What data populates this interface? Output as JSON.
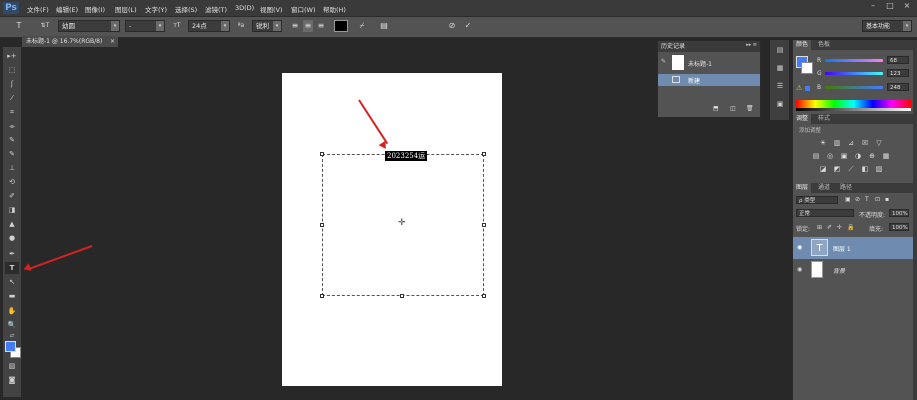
{
  "app": {
    "logo": "Ps"
  },
  "menu": [
    "文件(F)",
    "编辑(E)",
    "图像(I)",
    "图层(L)",
    "文字(Y)",
    "选择(S)",
    "滤镜(T)",
    "3D(D)",
    "视图(V)",
    "窗口(W)",
    "帮助(H)"
  ],
  "window_controls": {
    "minimize": "–",
    "maximize": "□",
    "close": "×"
  },
  "options": {
    "tool_glyph": "T",
    "orient_glyph": "⇅T",
    "font_family": "幼圆",
    "font_style": "-",
    "size_glyph": "тT",
    "font_size": "24点",
    "aa_glyph": "ªa",
    "antialias": "锐利",
    "align_left": "≡",
    "align_center": "≡",
    "align_right": "≡",
    "color_hex": "#000000",
    "warp_glyph": "⌿",
    "panel_glyph": "▤",
    "cancel_glyph": "⊘",
    "commit_glyph": "✓",
    "workspace": "基本功能"
  },
  "document": {
    "tab_label": "未标题-1 @ 16.7%(RGB/8)",
    "tab_close": "×",
    "selected_text": "2023254运",
    "center_glyph": "✛"
  },
  "toolbar": {
    "tools": [
      "▸+",
      "⬚",
      "ʃ",
      "⁄",
      "⌗",
      "⌯",
      "✎",
      "✎",
      "⊥",
      "⟲",
      "✐",
      "◨",
      "▲",
      "●",
      "✒",
      "T",
      "↖",
      "▬",
      "✋",
      "🔍",
      "⇄",
      "▨",
      "◙"
    ]
  },
  "history": {
    "tab": "历史记录",
    "tab_controls": "▸▸ ≡",
    "snapshot_label": "未标题-1",
    "state_label": "新建",
    "footer_icons": [
      "⬒",
      "◫",
      "🗑"
    ]
  },
  "mid_icons": [
    "▤",
    "▦",
    "☰",
    "▣"
  ],
  "color_panel": {
    "tabs": [
      "颜色",
      "色板"
    ],
    "channels": [
      {
        "name": "R",
        "value": "68"
      },
      {
        "name": "G",
        "value": "123"
      },
      {
        "name": "B",
        "value": "248"
      }
    ],
    "warn_glyph": "⚠",
    "fg": "#447bf8"
  },
  "adjust_panel": {
    "tabs": [
      "调整",
      "样式"
    ],
    "hint": "添加调整",
    "row1": [
      "☀",
      "▥",
      "⊿",
      "☒",
      "▽"
    ],
    "row2": [
      "▤",
      "◎",
      "▣",
      "◑",
      "⊕",
      "▦"
    ],
    "row3": [
      "◪",
      "◩",
      "⟋",
      "◧",
      "▨"
    ]
  },
  "layers_panel": {
    "tabs": [
      "图层",
      "通道",
      "路径"
    ],
    "filter_label": "ρ 类型",
    "filter_icons": [
      "▣",
      "⊘",
      "T",
      "⊡",
      "▪"
    ],
    "blend_mode": "正常",
    "opacity_label": "不透明度:",
    "opacity": "100%",
    "lock_label": "锁定:",
    "lock_icons": [
      "⊞",
      "✐",
      "✛",
      "🔒"
    ],
    "fill_label": "填充:",
    "fill": "100%",
    "layers": [
      {
        "name": "图层 1",
        "thumb": "T",
        "visible": "◉"
      },
      {
        "name": "背景",
        "thumb": "",
        "visible": "◉"
      }
    ]
  }
}
